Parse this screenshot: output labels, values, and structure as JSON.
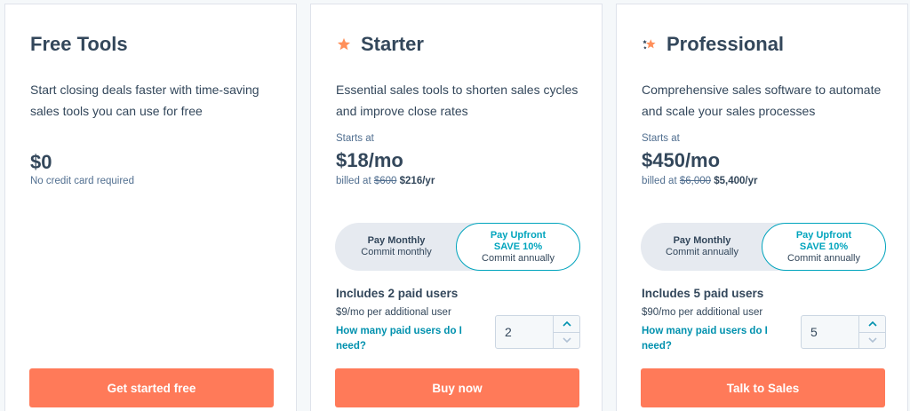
{
  "colors": {
    "accent": "#ff7a59",
    "link": "#0091ae",
    "toggle_active": "#00a4bd",
    "text": "#33475b"
  },
  "plans": [
    {
      "title": "Free Tools",
      "description": "Start closing deals faster with time-saving sales tools you can use for free",
      "price": "$0",
      "price_note": "No credit card required",
      "cta": "Get started free"
    },
    {
      "icon": "star-icon",
      "title": "Starter",
      "description": "Essential sales tools to shorten sales cycles and improve close rates",
      "starts_at": "Starts at",
      "price": "$18/mo",
      "billed_prefix": "billed at",
      "billed_old": "$600",
      "billed_new": "$216/yr",
      "toggle": {
        "monthly_label": "Pay Monthly",
        "monthly_sub": "Commit monthly",
        "upfront_label": "Pay Upfront",
        "upfront_save": "SAVE 10%",
        "upfront_sub": "Commit annually"
      },
      "includes": "Includes 2 paid users",
      "additional": "$9/mo per additional user",
      "help_link": "How many paid users do I need?",
      "users_value": "2",
      "cta": "Buy now"
    },
    {
      "icon": "stars-icon",
      "title": "Professional",
      "description": "Comprehensive sales software to automate and scale your sales processes",
      "starts_at": "Starts at",
      "price": "$450/mo",
      "billed_prefix": "billed at",
      "billed_old": "$6,000",
      "billed_new": "$5,400/yr",
      "toggle": {
        "monthly_label": "Pay Monthly",
        "monthly_sub": "Commit annually",
        "upfront_label": "Pay Upfront",
        "upfront_save": "SAVE 10%",
        "upfront_sub": "Commit annually"
      },
      "includes": "Includes 5 paid users",
      "additional": "$90/mo per additional user",
      "help_link": "How many paid users do I need?",
      "users_value": "5",
      "cta": "Talk to Sales"
    }
  ]
}
